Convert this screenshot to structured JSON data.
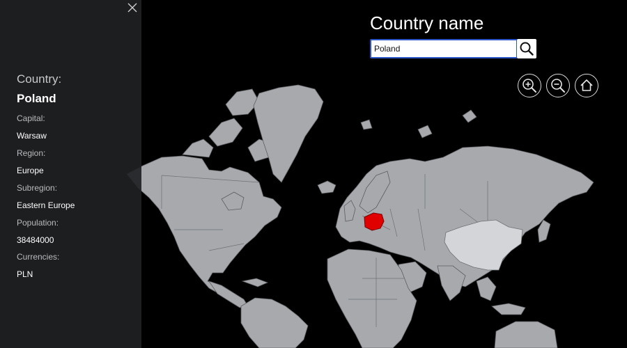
{
  "panel": {
    "heading": "Country:",
    "country": "Poland",
    "fields": [
      {
        "label": "Capital:",
        "value": "Warsaw"
      },
      {
        "label": "Region:",
        "value": "Europe"
      },
      {
        "label": "Subregion:",
        "value": "Eastern Europe"
      },
      {
        "label": "Population:",
        "value": "38484000"
      },
      {
        "label": "Currencies:",
        "value": "PLN"
      }
    ]
  },
  "search": {
    "title": "Country name",
    "value": "Poland"
  },
  "controls": {
    "zoom_in_icon": "zoom-in-icon",
    "zoom_out_icon": "zoom-out-icon",
    "home_icon": "home-icon"
  },
  "colors": {
    "background": "#000000",
    "land": "#a7a9ad",
    "selected_country": "#e00000",
    "highlighted_country": "#d3d5d8",
    "input_border": "#2b56c7"
  }
}
